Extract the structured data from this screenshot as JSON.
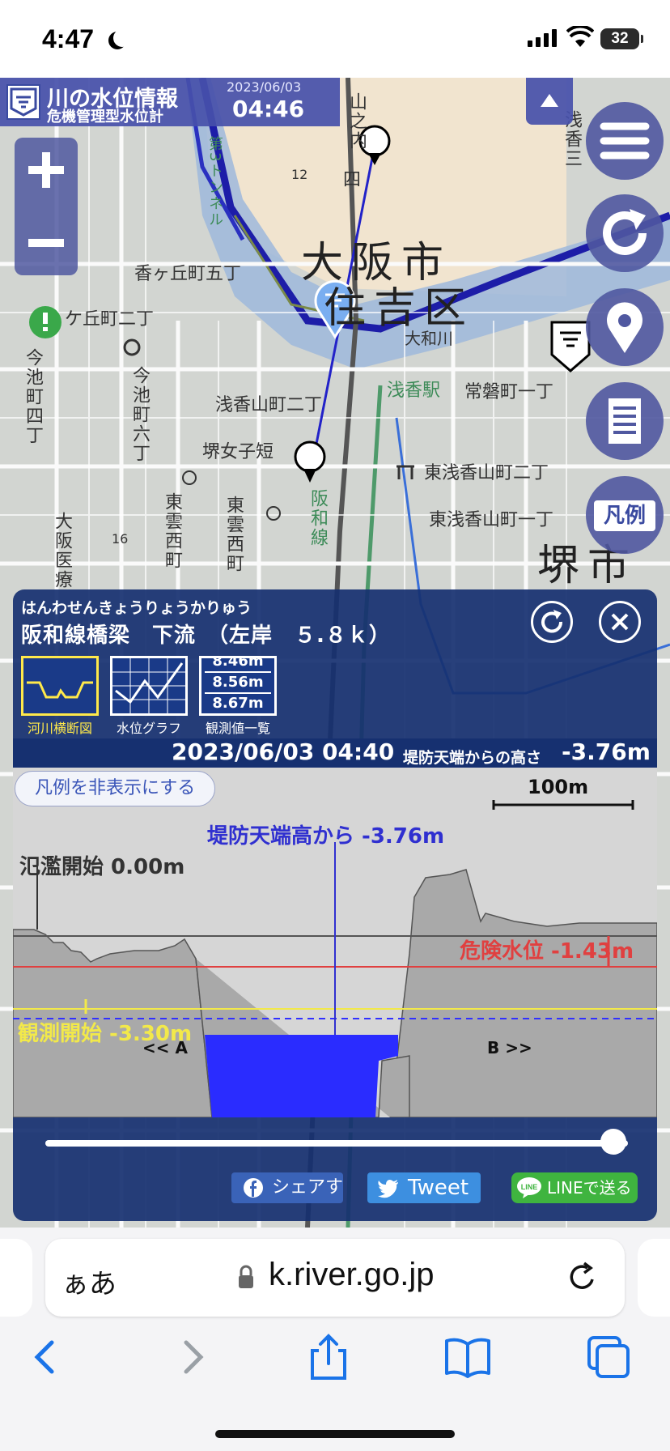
{
  "status_bar": {
    "time": "4:47",
    "battery": "32"
  },
  "header": {
    "title": "川の水位情報",
    "subtitle": "危機管理型水位計",
    "date": "2023/06/03",
    "time": "04:46"
  },
  "map_labels": {
    "district_osaka": "大阪市",
    "district_sumiyoshi": "住吉区",
    "district_sakai": "堺市",
    "station_asaka": "浅香駅",
    "river": "大和川",
    "tokiwa": "常磐町一丁",
    "asakayama_2": "浅香山町二丁",
    "higashi_asakayama_2": "東浅香山町二丁",
    "higashi_asakayama_1": "東浅香山町一丁",
    "kasugaoka_5": "香ヶ丘町五丁",
    "kasugaoka_2": "ケ丘町二丁",
    "sakai_jotan": "堺女子短",
    "hanwa_line": "阪和線",
    "imaike_6": "今池町六丁",
    "imaike_4": "今池町四丁",
    "higashi_unemachi": "東雲西町",
    "higashi_unemachi2": "東雲西町",
    "osaka_iryo": "大阪医療",
    "tunnel": "第3トンネル",
    "yamanouchi": "山之内",
    "four": "四",
    "twelve": "12",
    "sixteen": "16",
    "asaka_3": "浅香三",
    "point_a": "A",
    "point_b": "B",
    "legend_chars": "凡例"
  },
  "panel": {
    "kana": "はんわせんきょうりょうかりゅう",
    "station": "阪和線橋梁　下流　（左岸　５.８ｋ）",
    "tabs": [
      {
        "label": "河川横断図"
      },
      {
        "label": "水位グラフ"
      },
      {
        "label": "観測値一覧"
      }
    ],
    "table_values": [
      "8.46m",
      "8.56m",
      "8.67m"
    ],
    "obs_datetime": "2023/06/03 04:40",
    "obs_caption": "堤防天端からの高さ",
    "obs_value": "-3.76m",
    "legend_toggle": "凡例を非表示にする",
    "scale_label": "100m",
    "crest_label": "堤防天端高から -3.76m",
    "flood_start": "氾濫開始 0.00m",
    "danger_level": "危険水位 -1.43m",
    "obs_start": "観測開始 -3.30m",
    "left_bank": "<< A",
    "right_bank": "B >>",
    "share_facebook": "シェアす",
    "share_tweet": "Tweet",
    "share_line": "LINEで送る"
  },
  "browser": {
    "aa": "ぁあ",
    "url": "k.river.go.jp"
  },
  "colors": {
    "panel_bg": "#163070",
    "water": "#2a2cff",
    "danger": "#e04040",
    "observe": "#f2e94a",
    "crest_line": "#3030d0"
  }
}
